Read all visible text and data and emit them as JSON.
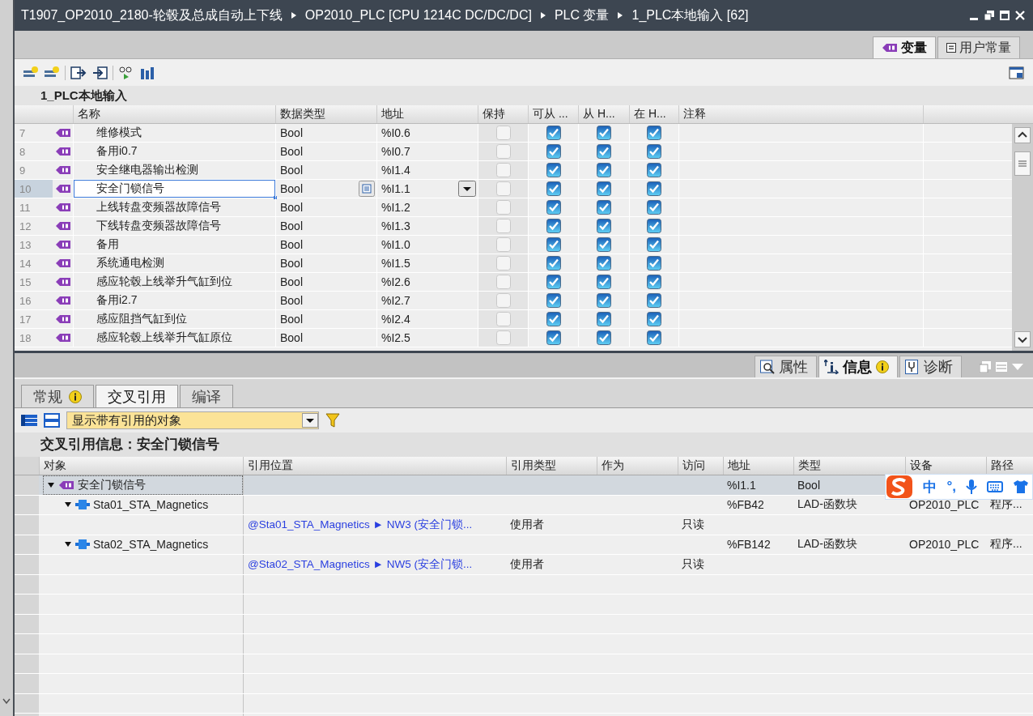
{
  "breadcrumb": [
    "T1907_OP2010_2180-轮毂及总成自动上下线",
    "OP2010_PLC [CPU 1214C DC/DC/DC]",
    "PLC 变量",
    "1_PLC本地输入 [62]"
  ],
  "editor_tabs": [
    {
      "label": "变量",
      "selected": true
    },
    {
      "label": "用户常量",
      "selected": false
    }
  ],
  "table": {
    "title": "1_PLC本地输入",
    "columns": [
      "名称",
      "数据类型",
      "地址",
      "保持",
      "可从 ...",
      "从 H...",
      "在 H...",
      "注释"
    ],
    "rows": [
      {
        "number": "7",
        "name": "维修模式",
        "data_type": "Bool",
        "address": "%I0.6",
        "retain": false,
        "accessible": true,
        "writable": true,
        "visible": true,
        "selected": false
      },
      {
        "number": "8",
        "name": "备用i0.7",
        "data_type": "Bool",
        "address": "%I0.7",
        "retain": false,
        "accessible": true,
        "writable": true,
        "visible": true,
        "selected": false
      },
      {
        "number": "9",
        "name": "安全继电器输出检测",
        "data_type": "Bool",
        "address": "%I1.4",
        "retain": false,
        "accessible": true,
        "writable": true,
        "visible": true,
        "selected": false
      },
      {
        "number": "10",
        "name": "安全门锁信号",
        "data_type": "Bool",
        "address": "%I1.1",
        "retain": false,
        "accessible": true,
        "writable": true,
        "visible": true,
        "selected": true
      },
      {
        "number": "11",
        "name": "上线转盘变频器故障信号",
        "data_type": "Bool",
        "address": "%I1.2",
        "retain": false,
        "accessible": true,
        "writable": true,
        "visible": true,
        "selected": false
      },
      {
        "number": "12",
        "name": "下线转盘变频器故障信号",
        "data_type": "Bool",
        "address": "%I1.3",
        "retain": false,
        "accessible": true,
        "writable": true,
        "visible": true,
        "selected": false
      },
      {
        "number": "13",
        "name": "备用",
        "data_type": "Bool",
        "address": "%I1.0",
        "retain": false,
        "accessible": true,
        "writable": true,
        "visible": true,
        "selected": false
      },
      {
        "number": "14",
        "name": "系统通电检测",
        "data_type": "Bool",
        "address": "%I1.5",
        "retain": false,
        "accessible": true,
        "writable": true,
        "visible": true,
        "selected": false
      },
      {
        "number": "15",
        "name": "感应轮毂上线举升气缸到位",
        "data_type": "Bool",
        "address": "%I2.6",
        "retain": false,
        "accessible": true,
        "writable": true,
        "visible": true,
        "selected": false
      },
      {
        "number": "16",
        "name": "备用i2.7",
        "data_type": "Bool",
        "address": "%I2.7",
        "retain": false,
        "accessible": true,
        "writable": true,
        "visible": true,
        "selected": false
      },
      {
        "number": "17",
        "name": "感应阻挡气缸到位",
        "data_type": "Bool",
        "address": "%I2.4",
        "retain": false,
        "accessible": true,
        "writable": true,
        "visible": true,
        "selected": false
      },
      {
        "number": "18",
        "name": "感应轮毂上线举升气缸原位",
        "data_type": "Bool",
        "address": "%I2.5",
        "retain": false,
        "accessible": true,
        "writable": true,
        "visible": true,
        "selected": false
      }
    ]
  },
  "inspector_tabs": [
    {
      "label": "属性",
      "selected": false,
      "info": false
    },
    {
      "label": "信息",
      "selected": true,
      "info": true
    },
    {
      "label": "诊断",
      "selected": false,
      "info": false
    }
  ],
  "sub_tabs": [
    {
      "label": "常规",
      "selected": false,
      "info": true
    },
    {
      "label": "交叉引用",
      "selected": true,
      "info": false
    },
    {
      "label": "编译",
      "selected": false,
      "info": false
    }
  ],
  "filter": {
    "value": "显示带有引用的对象"
  },
  "xref": {
    "title": "交叉引用信息：安全门锁信号",
    "columns": [
      "对象",
      "引用位置",
      "引用类型",
      "作为",
      "访问",
      "地址",
      "类型",
      "设备",
      "路径"
    ],
    "rows": [
      {
        "kind": "tag",
        "object": "安全门锁信号",
        "address": "%I1.1",
        "type": "Bool",
        "expanded": true,
        "selected": true,
        "children": [
          {
            "kind": "block",
            "object": "Sta01_STA_Magnetics",
            "address": "%FB42",
            "type": "LAD-函数块",
            "device": "OP2010_PLC",
            "path": "程序...",
            "expanded": true,
            "selected": false,
            "children": [
              {
                "kind": "reference",
                "location": "@Sta01_STA_Magnetics ► NW3 (安全门锁...",
                "ref_type": "使用者",
                "access": "只读",
                "selected": false
              }
            ]
          },
          {
            "kind": "block",
            "object": "Sta02_STA_Magnetics",
            "address": "%FB142",
            "type": "LAD-函数块",
            "device": "OP2010_PLC",
            "path": "程序...",
            "expanded": true,
            "selected": false,
            "children": [
              {
                "kind": "reference",
                "location": "@Sta02_STA_Magnetics ► NW5 (安全门锁...",
                "ref_type": "使用者",
                "access": "只读",
                "selected": false
              }
            ]
          }
        ]
      }
    ]
  },
  "ime": {
    "labels": [
      "中",
      "°,"
    ]
  }
}
